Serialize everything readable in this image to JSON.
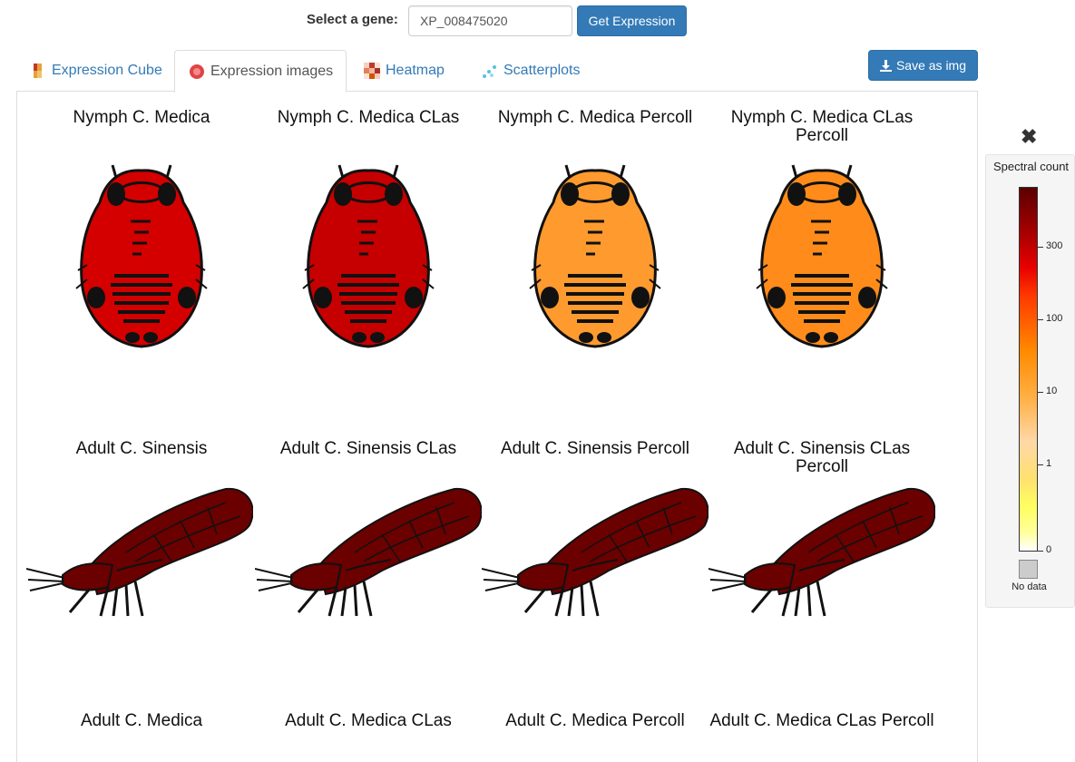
{
  "gene_selector": {
    "label": "Select a gene:",
    "value": "XP_008475020",
    "button": "Get Expression"
  },
  "tabs": [
    {
      "label": "Expression Cube",
      "icon": "cube-icon"
    },
    {
      "label": "Expression images",
      "icon": "expression-image-icon"
    },
    {
      "label": "Heatmap",
      "icon": "heatmap-icon"
    },
    {
      "label": "Scatterplots",
      "icon": "scatterplot-icon"
    }
  ],
  "save_button": "Save as img",
  "samples": [
    {
      "title": "Nymph C. Medica",
      "stage": "nymph",
      "color": "#d40000"
    },
    {
      "title": "Nymph C. Medica CLas",
      "stage": "nymph",
      "color": "#c60000"
    },
    {
      "title": "Nymph C. Medica Percoll",
      "stage": "nymph",
      "color": "#ff9b2e"
    },
    {
      "title": "Nymph C. Medica CLas Percoll",
      "stage": "nymph",
      "color": "#ff8c1a"
    },
    {
      "title": "Adult C. Sinensis",
      "stage": "adult",
      "color": "#6b0000"
    },
    {
      "title": "Adult C. Sinensis CLas",
      "stage": "adult",
      "color": "#6b0000"
    },
    {
      "title": "Adult C. Sinensis Percoll",
      "stage": "adult",
      "color": "#6b0000"
    },
    {
      "title": "Adult C. Sinensis CLas Percoll",
      "stage": "adult",
      "color": "#6b0000"
    },
    {
      "title": "Adult C. Medica",
      "stage": "adult"
    },
    {
      "title": "Adult C. Medica CLas",
      "stage": "adult"
    },
    {
      "title": "Adult C. Medica Percoll",
      "stage": "adult"
    },
    {
      "title": "Adult C. Medica CLas Percoll",
      "stage": "adult"
    }
  ],
  "legend": {
    "close_icon": "close-icon",
    "title": "Spectral count",
    "ticks": [
      "300",
      "100",
      "10",
      "1",
      "0"
    ],
    "no_data": "No data",
    "no_data_color": "#cccccc"
  }
}
